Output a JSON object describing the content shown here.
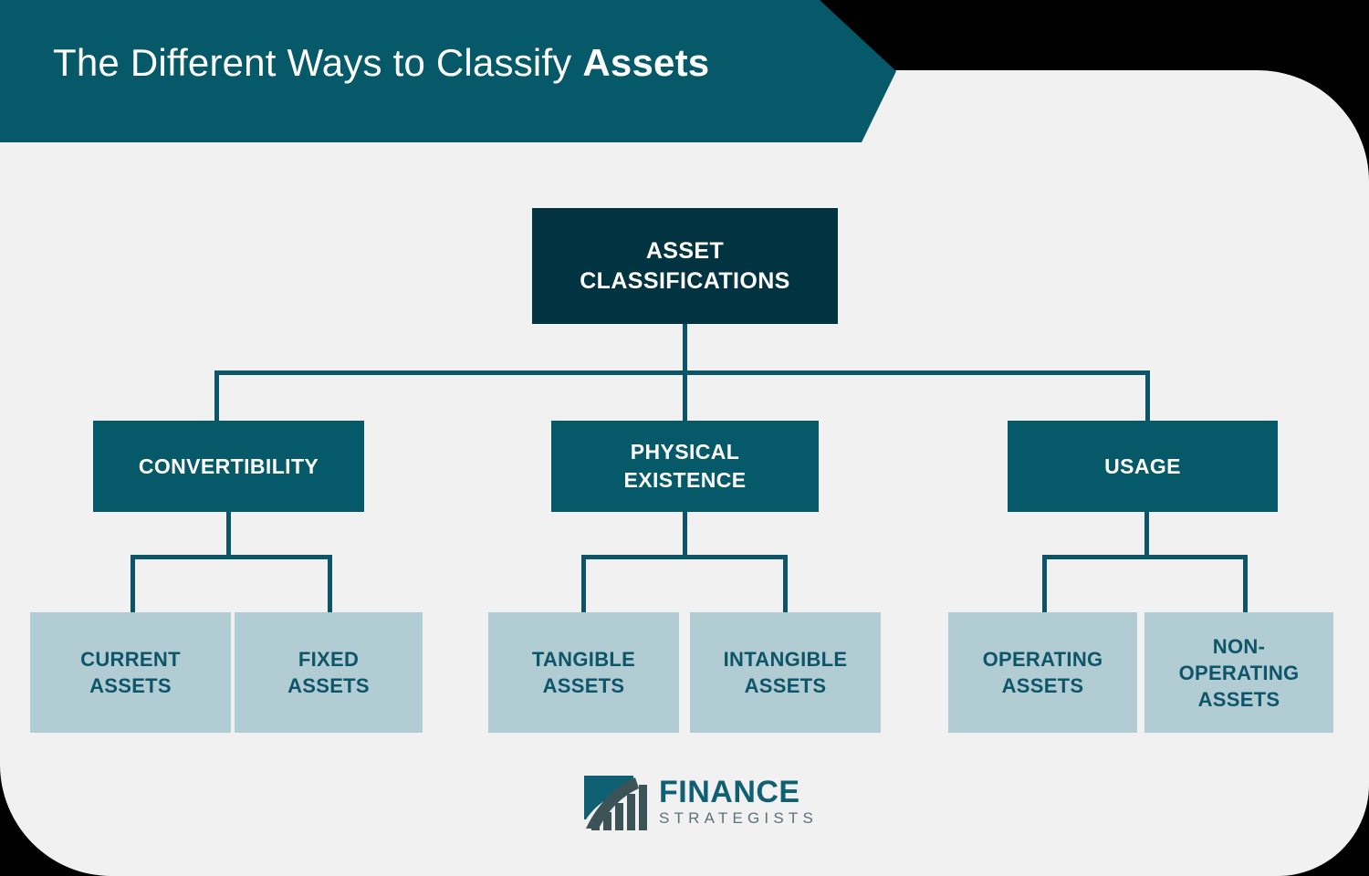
{
  "banner": {
    "title_prefix": "The Different Ways to Classify ",
    "title_strong": "Assets"
  },
  "colors": {
    "banner_bg": "#065968",
    "card_bg": "#f1f1f1",
    "root_bg": "#023340",
    "branch_bg": "#065968",
    "leaf_bg": "#b2ccd3",
    "leaf_text": "#0d5568",
    "connector": "#0c5468",
    "logo_teal": "#0f6073",
    "logo_slate": "#3c5358",
    "logo_gray": "#5d7076"
  },
  "diagram": {
    "type": "tree",
    "root": {
      "label": "ASSET\nCLASSIFICATIONS"
    },
    "branches": [
      {
        "label": "CONVERTIBILITY",
        "children": [
          {
            "label": "CURRENT\nASSETS"
          },
          {
            "label": "FIXED\nASSETS"
          }
        ]
      },
      {
        "label": "PHYSICAL\nEXISTENCE",
        "children": [
          {
            "label": "TANGIBLE\nASSETS"
          },
          {
            "label": "INTANGIBLE\nASSETS"
          }
        ]
      },
      {
        "label": "USAGE",
        "children": [
          {
            "label": "OPERATING\nASSETS"
          },
          {
            "label": "NON-\nOPERATING\nASSETS"
          }
        ]
      }
    ]
  },
  "logo": {
    "mark": "finance-strategists-logo-icon",
    "word_primary": "FINANCE",
    "word_secondary": "STRATEGISTS"
  }
}
